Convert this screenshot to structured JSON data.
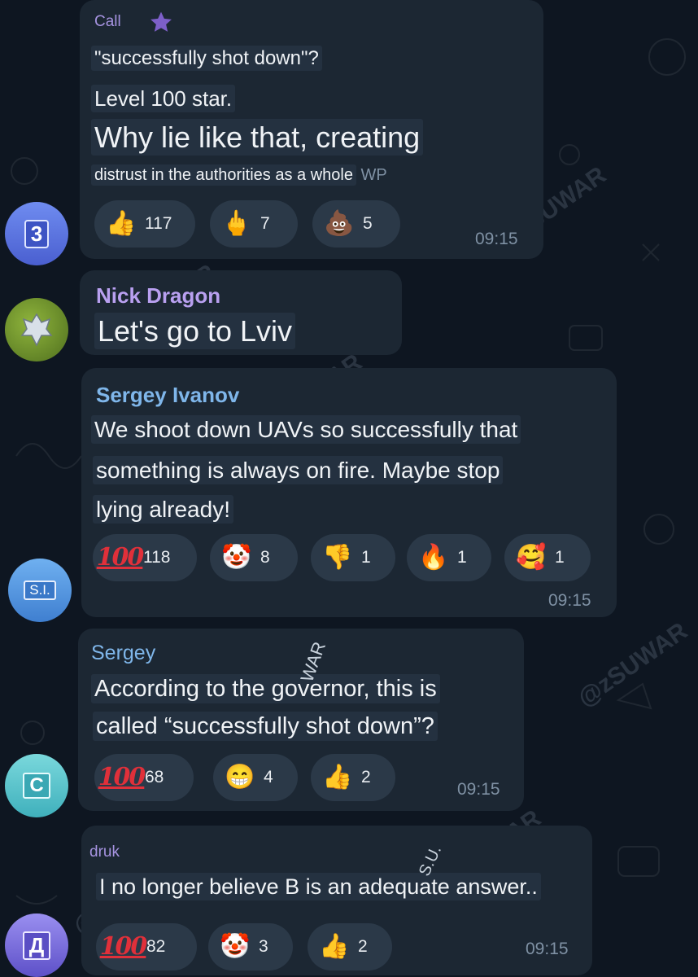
{
  "messages": [
    {
      "sender": "Call",
      "lines": [
        "\"successfully shot down\"?",
        "Level 100 star.",
        "Why lie like that, creating",
        "distrust in the authorities as a whole"
      ],
      "suffix": "WP",
      "reactions": [
        {
          "emoji": "👍",
          "count": "117"
        },
        {
          "emoji": "🖕",
          "count": "7"
        },
        {
          "emoji": "💩",
          "count": "5"
        }
      ],
      "time": "09:15"
    },
    {
      "sender": "Nick Dragon",
      "lines": [
        "Let's go to Lviv"
      ]
    },
    {
      "sender": "Sergey Ivanov",
      "lines": [
        "We shoot down UAVs so successfully that",
        "something is always on fire. Maybe stop",
        "lying already!"
      ],
      "reactions": [
        {
          "emoji": "100",
          "count": "118"
        },
        {
          "emoji": "🤡",
          "count": "8"
        },
        {
          "emoji": "👎",
          "count": "1"
        },
        {
          "emoji": "🔥",
          "count": "1"
        },
        {
          "emoji": "🥰",
          "count": "1"
        }
      ],
      "time": "09:15"
    },
    {
      "sender": "Sergey",
      "lines": [
        "According to the governor, this is",
        "called “successfully shot down”?"
      ],
      "reactions": [
        {
          "emoji": "100",
          "count": "68"
        },
        {
          "emoji": "😁",
          "count": "4"
        },
        {
          "emoji": "👍",
          "count": "2"
        }
      ],
      "time": "09:15"
    },
    {
      "sender": "druk",
      "lines": [
        "I no longer believe B is an adequate answer.."
      ],
      "reactions": [
        {
          "emoji": "100",
          "count": "82"
        },
        {
          "emoji": "🤡",
          "count": "3"
        },
        {
          "emoji": "👍",
          "count": "2"
        }
      ],
      "time": "09:15"
    }
  ],
  "avatars": [
    {
      "label": "3",
      "color": "#4f6fd8"
    },
    {
      "label": "",
      "color": "#6a8f2c"
    },
    {
      "label": "S.I.",
      "color": "#4c8fd6"
    },
    {
      "label": "C",
      "color": "#4fc0c9"
    },
    {
      "label": "Д",
      "color": "#7b6fd6"
    }
  ],
  "watermarks": [
    "@zSUWAR",
    "WAR",
    "S.U."
  ],
  "colors": {
    "background": "#0e1621",
    "bubble": "#1c2733",
    "sender_call": "#a693e0",
    "sender_nick": "#b9a0f0",
    "sender_sergey_ivanov": "#7fb6ea",
    "sender_sergey": "#7fb6ea",
    "sender_druk": "#a693e0"
  },
  "icons": {
    "star": "star-icon"
  }
}
